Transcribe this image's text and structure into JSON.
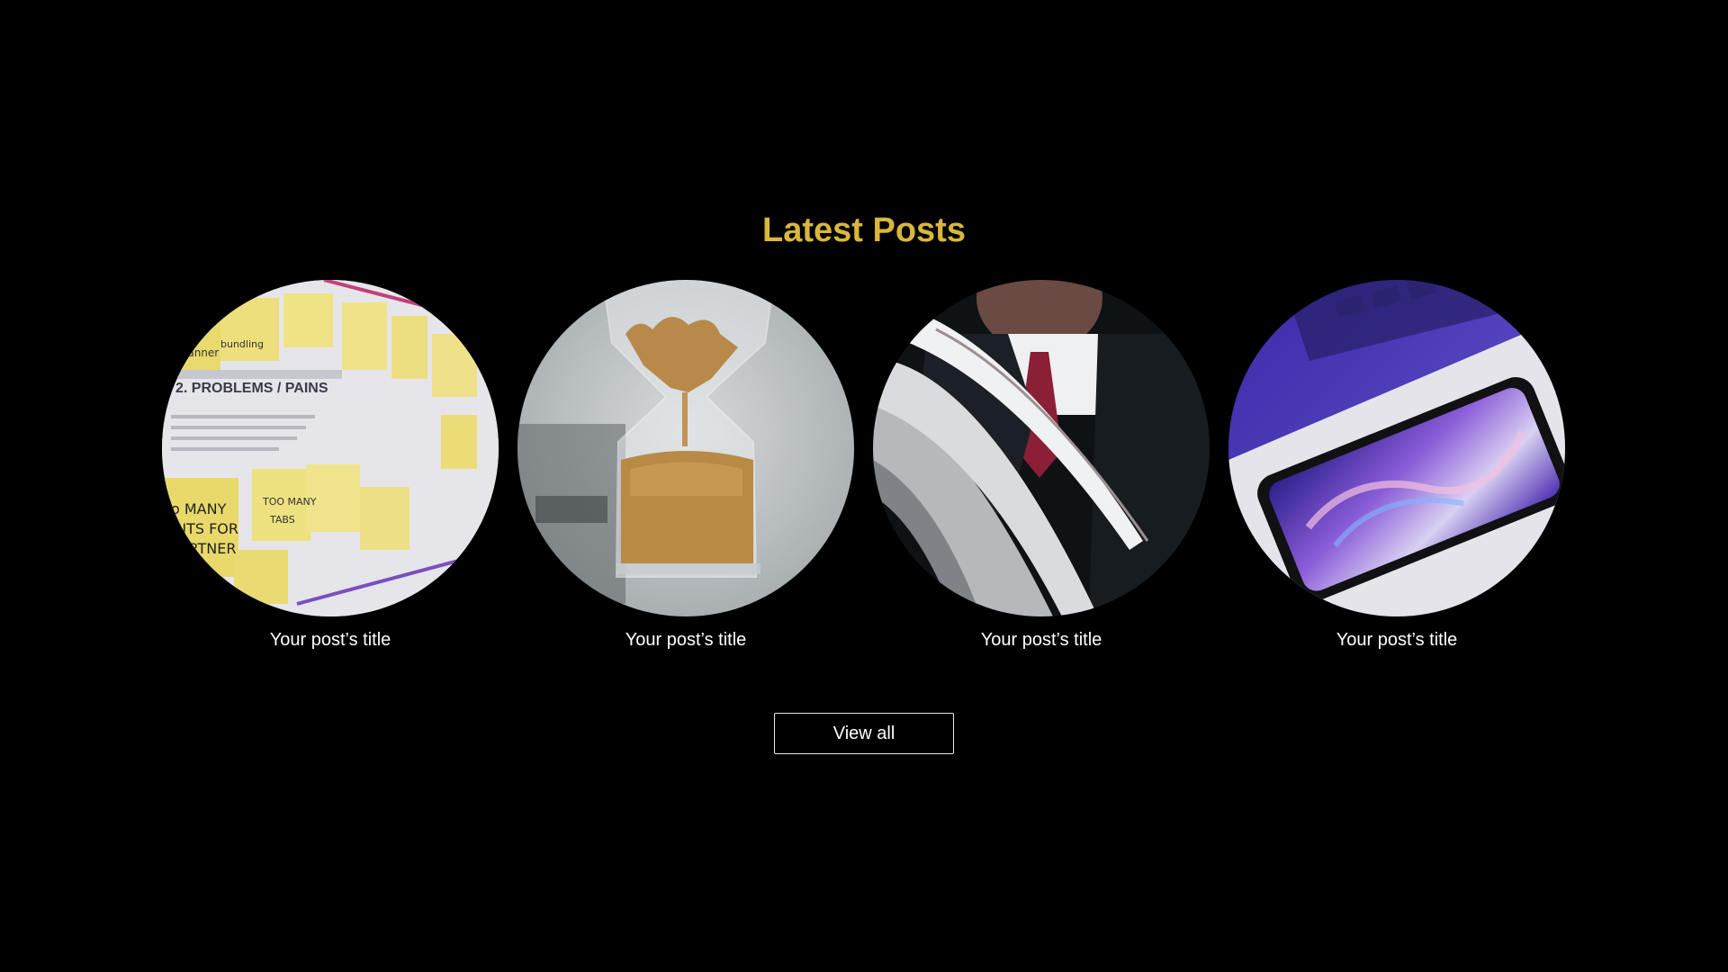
{
  "section": {
    "heading": "Latest Posts",
    "accent_color": "#d8b73c"
  },
  "posts": [
    {
      "title": "Your post’s title",
      "image": "sticky-notes-board-image"
    },
    {
      "title": "Your post’s title",
      "image": "hourglass-image"
    },
    {
      "title": "Your post’s title",
      "image": "man-reading-magazine-image"
    },
    {
      "title": "Your post’s title",
      "image": "smartphone-on-laptop-image"
    }
  ],
  "view_all_label": "View all"
}
